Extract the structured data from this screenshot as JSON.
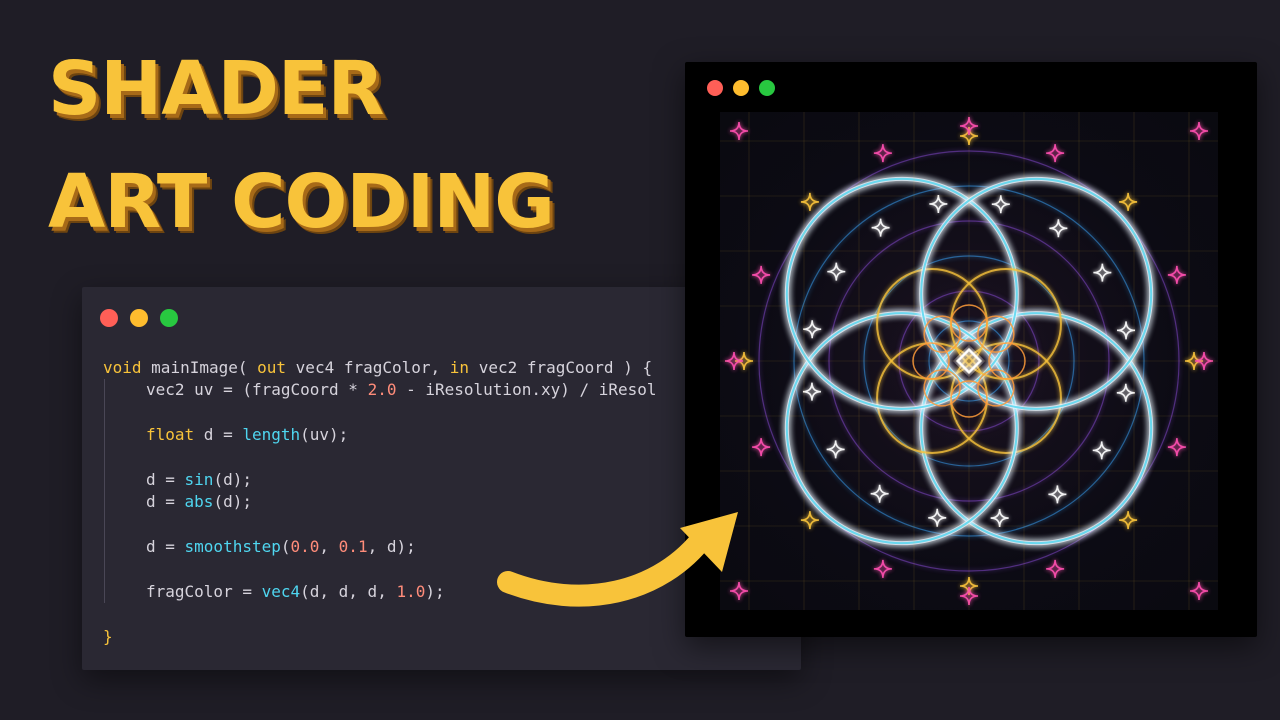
{
  "title": {
    "line1": "SHADER",
    "line2": "ART CODING"
  },
  "colors": {
    "accent": "#f8c33a",
    "background": "#1f1d26",
    "close": "#ff5f57",
    "minimize": "#febc2e",
    "maximize": "#28c840"
  },
  "code_window": {
    "lines": [
      {
        "indent": false,
        "tokens": [
          [
            "kw",
            "void "
          ],
          [
            "op",
            "mainImage( "
          ],
          [
            "kw",
            "out "
          ],
          [
            "op",
            "vec4 fragColor, "
          ],
          [
            "kw",
            "in "
          ],
          [
            "op",
            "vec2 fragCoord ) {"
          ]
        ]
      },
      {
        "indent": true,
        "tokens": [
          [
            "op",
            "vec2 uv = (fragCoord * "
          ],
          [
            "num",
            "2.0"
          ],
          [
            "op",
            " - iResolution.xy) / iResol"
          ]
        ]
      },
      {
        "indent": true,
        "tokens": []
      },
      {
        "indent": true,
        "tokens": [
          [
            "kw",
            "float "
          ],
          [
            "op",
            "d = "
          ],
          [
            "fn",
            "length"
          ],
          [
            "op",
            "(uv);"
          ]
        ]
      },
      {
        "indent": true,
        "tokens": []
      },
      {
        "indent": true,
        "tokens": [
          [
            "op",
            "d = "
          ],
          [
            "fn",
            "sin"
          ],
          [
            "op",
            "(d);"
          ]
        ]
      },
      {
        "indent": true,
        "tokens": [
          [
            "op",
            "d = "
          ],
          [
            "fn",
            "abs"
          ],
          [
            "op",
            "(d);"
          ]
        ]
      },
      {
        "indent": true,
        "tokens": []
      },
      {
        "indent": true,
        "tokens": [
          [
            "op",
            "d = "
          ],
          [
            "fn",
            "smoothstep"
          ],
          [
            "op",
            "("
          ],
          [
            "num",
            "0.0"
          ],
          [
            "op",
            ", "
          ],
          [
            "num",
            "0.1"
          ],
          [
            "op",
            ", d);"
          ]
        ]
      },
      {
        "indent": true,
        "tokens": []
      },
      {
        "indent": true,
        "tokens": [
          [
            "op",
            "fragColor = "
          ],
          [
            "fn",
            "vec4"
          ],
          [
            "op",
            "(d, d, d, "
          ],
          [
            "num",
            "1.0"
          ],
          [
            "op",
            ");"
          ]
        ]
      },
      {
        "indent": false,
        "tokens": []
      },
      {
        "indent": false,
        "tokens": [
          [
            "kw",
            "}"
          ]
        ]
      }
    ]
  }
}
